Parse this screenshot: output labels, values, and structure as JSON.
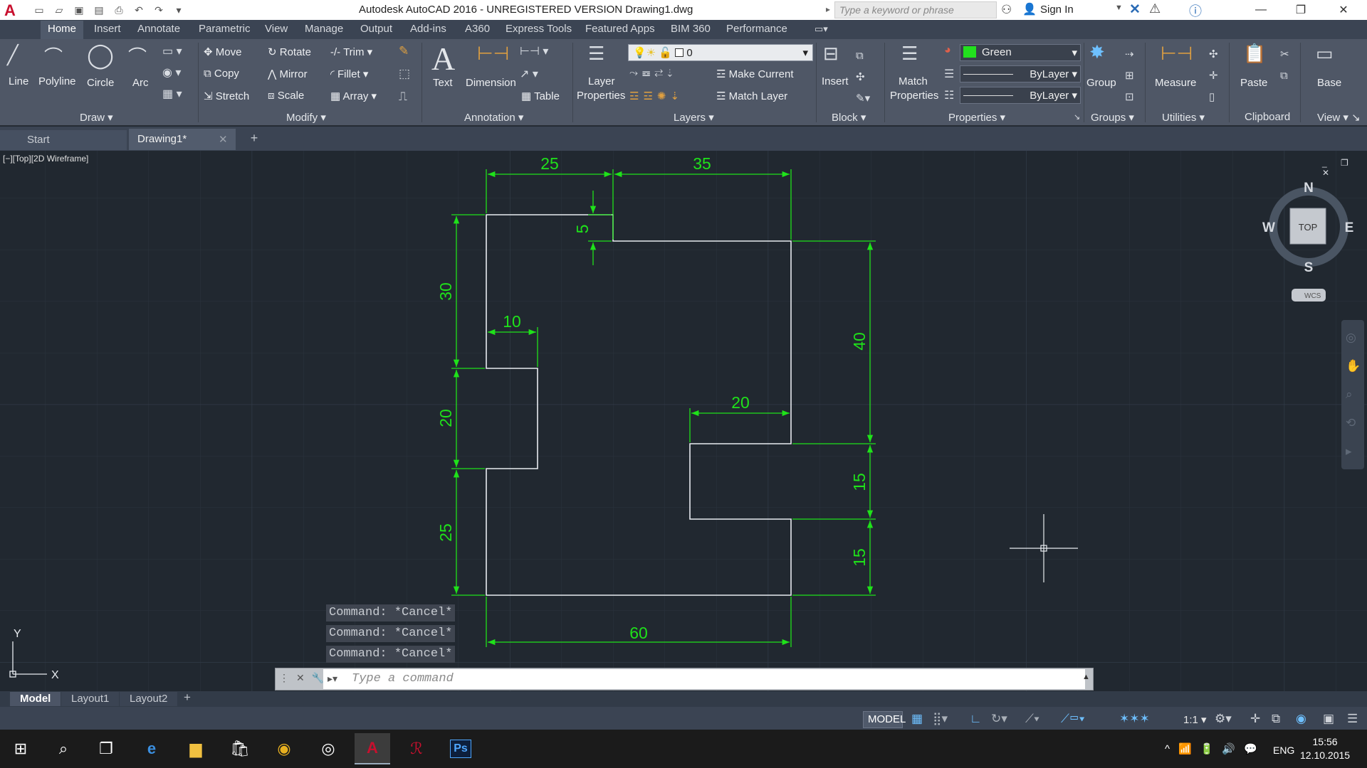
{
  "window": {
    "title": "Autodesk AutoCAD 2016 - UNREGISTERED VERSION    Drawing1.dwg",
    "search_placeholder": "Type a keyword or phrase",
    "sign_in": "Sign In"
  },
  "ribbon_tabs": [
    "Home",
    "Insert",
    "Annotate",
    "Parametric",
    "View",
    "Manage",
    "Output",
    "Add-ins",
    "A360",
    "Express Tools",
    "Featured Apps",
    "BIM 360",
    "Performance"
  ],
  "draw": {
    "line": "Line",
    "polyline": "Polyline",
    "circle": "Circle",
    "arc": "Arc",
    "panel": "Draw"
  },
  "modify": {
    "move": "Move",
    "rotate": "Rotate",
    "trim": "Trim",
    "copy": "Copy",
    "mirror": "Mirror",
    "fillet": "Fillet",
    "stretch": "Stretch",
    "scale": "Scale",
    "array": "Array",
    "panel": "Modify"
  },
  "annotation": {
    "text": "Text",
    "dimension": "Dimension",
    "table": "Table",
    "panel": "Annotation"
  },
  "layers": {
    "layer_properties_1": "Layer",
    "layer_properties_2": "Properties",
    "current_layer": "0",
    "make_current": "Make Current",
    "match_layer": "Match Layer",
    "panel": "Layers"
  },
  "block": {
    "insert": "Insert",
    "panel": "Block"
  },
  "properties": {
    "match_1": "Match",
    "match_2": "Properties",
    "color": "Green",
    "linetype": "ByLayer",
    "lineweight": "ByLayer",
    "panel": "Properties",
    "color_hex": "#22e01e"
  },
  "groups": {
    "group": "Group",
    "panel": "Groups"
  },
  "utilities": {
    "measure": "Measure",
    "panel": "Utilities"
  },
  "clipboard": {
    "paste": "Paste",
    "panel": "Clipboard"
  },
  "view_panel": {
    "base": "Base",
    "panel": "View"
  },
  "file_tabs": {
    "start": "Start",
    "drawing": "Drawing1*"
  },
  "viewport": {
    "label": "[−][Top][2D Wireframe]",
    "viewcube": {
      "n": "N",
      "s": "S",
      "e": "E",
      "w": "W",
      "top": "TOP",
      "wcs": "WCS"
    },
    "ucs": {
      "x": "X",
      "y": "Y"
    }
  },
  "dimensions": {
    "d25_top": "25",
    "d35_top": "35",
    "d5": "5",
    "d30": "30",
    "d10": "10",
    "d20_left": "20",
    "d25_left": "25",
    "d40": "40",
    "d20_mid": "20",
    "d15_upper": "15",
    "d15_lower": "15",
    "d60": "60"
  },
  "command": {
    "history": [
      "Command: *Cancel*",
      "Command: *Cancel*",
      "Command: *Cancel*"
    ],
    "placeholder": "Type a command"
  },
  "layout_tabs": [
    "Model",
    "Layout1",
    "Layout2"
  ],
  "status": {
    "model": "MODEL",
    "scale": "1:1"
  },
  "tray": {
    "lang": "ENG",
    "time": "15:56",
    "date": "12.10.2015"
  }
}
